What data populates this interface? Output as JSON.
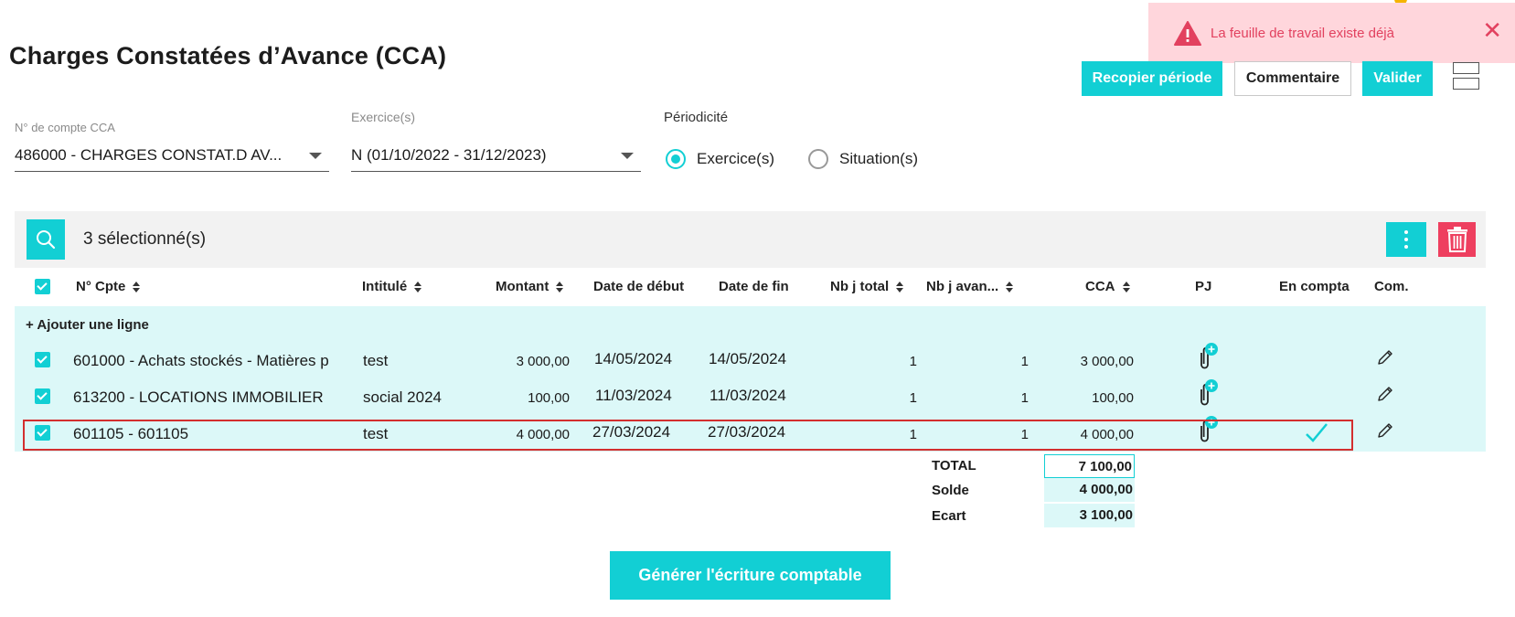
{
  "page": {
    "title": "Charges Constatées d’Avance (CCA)"
  },
  "toast": {
    "message": "La feuille de travail existe déjà",
    "close_glyph": "✕"
  },
  "actions": {
    "copy_period": "Recopier période",
    "comment": "Commentaire",
    "validate": "Valider"
  },
  "filters": {
    "account_label": "N° de compte CCA",
    "account_value": "486000 - CHARGES CONSTAT.D AV...",
    "exercise_label": "Exercice(s)",
    "exercise_value": "N (01/10/2022 - 31/12/2023)",
    "periodicity_label": "Périodicité",
    "options": [
      {
        "label": "Exercice(s)",
        "selected": true
      },
      {
        "label": "Situation(s)",
        "selected": false
      }
    ]
  },
  "toolbar": {
    "selected_text": "3 sélectionné(s)"
  },
  "table": {
    "columns": [
      {
        "label": "N° Cpte",
        "sortable": true
      },
      {
        "label": "Intitulé",
        "sortable": true
      },
      {
        "label": "Montant",
        "sortable": true
      },
      {
        "label": "Date de début",
        "sortable": false
      },
      {
        "label": "Date de fin",
        "sortable": false
      },
      {
        "label": "Nb j total",
        "sortable": true
      },
      {
        "label": "Nb j avan...",
        "sortable": true
      },
      {
        "label": "CCA",
        "sortable": true
      },
      {
        "label": "PJ",
        "sortable": false
      },
      {
        "label": "En compta",
        "sortable": false
      },
      {
        "label": "Com.",
        "sortable": false
      }
    ],
    "add_line": "+ Ajouter une ligne",
    "rows": [
      {
        "account": "601000 - Achats stockés - Matières p",
        "label": "test",
        "amount": "3 000,00",
        "start": "14/05/2024",
        "end": "14/05/2024",
        "days_total": "1",
        "days_advance": "1",
        "cca": "3 000,00",
        "in_accounting": false
      },
      {
        "account": "613200 - LOCATIONS IMMOBILIER",
        "label": "social 2024",
        "amount": "100,00",
        "start": "11/03/2024",
        "end": "11/03/2024",
        "days_total": "1",
        "days_advance": "1",
        "cca": "100,00",
        "in_accounting": false
      },
      {
        "account": "601105 - 601105",
        "label": "test",
        "amount": "4 000,00",
        "start": "27/03/2024",
        "end": "27/03/2024",
        "days_total": "1",
        "days_advance": "1",
        "cca": "4 000,00",
        "in_accounting": true
      }
    ]
  },
  "totals": {
    "total_label": "TOTAL",
    "total_value": "7 100,00",
    "balance_label": "Solde",
    "balance_value": "4 000,00",
    "gap_label": "Ecart",
    "gap_value": "3 100,00"
  },
  "generate_button": "Générer l'écriture comptable",
  "colors": {
    "accent": "#12cfd4",
    "danger": "#ee3f5f",
    "row_bg": "#dcf8f8",
    "toast_bg": "#ffd6dc"
  }
}
